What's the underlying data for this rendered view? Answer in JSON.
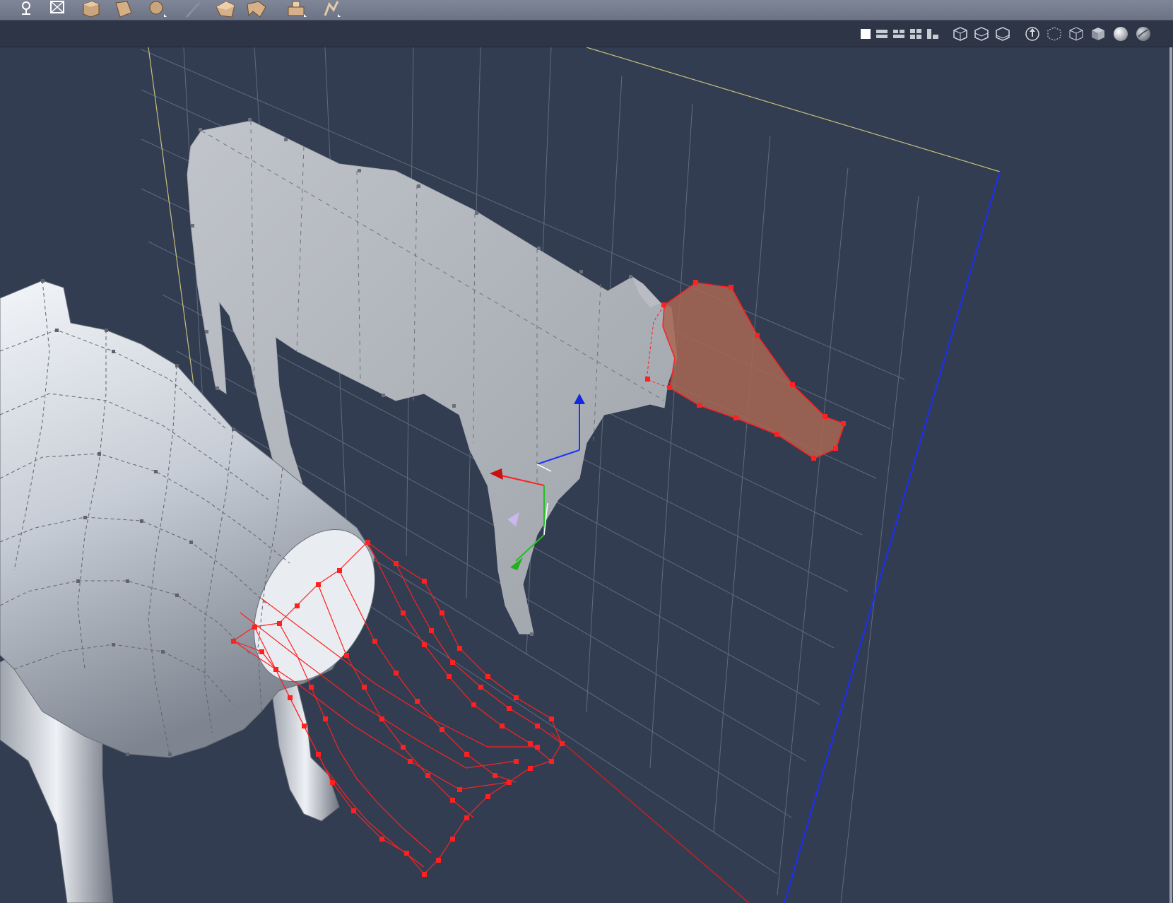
{
  "app": {
    "title": ""
  },
  "toolbar": {
    "tools": [
      {
        "icon": "light-bulb-icon"
      },
      {
        "icon": "frame-icon"
      },
      {
        "icon": "box-primitive-icon"
      },
      {
        "icon": "plane-primitive-icon"
      },
      {
        "icon": "sphere-primitive-icon"
      },
      {
        "icon": "edit-wand-icon"
      },
      {
        "icon": "deform-tool-icon"
      },
      {
        "icon": "bend-tool-icon"
      },
      {
        "icon": "extrude-tool-icon"
      },
      {
        "icon": "magnet-tool-icon"
      }
    ]
  },
  "view_controls": {
    "layouts": [
      {
        "icon": "single-view-icon",
        "active": true
      },
      {
        "icon": "two-horizontal-views-icon"
      },
      {
        "icon": "two-vertical-views-icon"
      },
      {
        "icon": "four-views-icon"
      },
      {
        "icon": "three-views-icon"
      }
    ],
    "shading_modes": [
      {
        "icon": "wire-hidden-icon"
      },
      {
        "icon": "wire-shaded-icon"
      },
      {
        "icon": "wire-lit-icon"
      },
      {
        "icon": "axis-tripod-icon"
      },
      {
        "icon": "bounding-box-dotted-icon"
      },
      {
        "icon": "wireframe-cube-icon"
      },
      {
        "icon": "solid-cube-icon"
      },
      {
        "icon": "smooth-sphere-icon"
      },
      {
        "icon": "textured-sphere-icon"
      }
    ]
  },
  "colors": {
    "viewport_bg": "#323d51",
    "toolbar_bg": "#767d8f",
    "selection": "#ff2020",
    "mesh": "#c8ccd2",
    "grid": "#6a7588",
    "axis_x": "#ff3030",
    "axis_y": "#20c020",
    "axis_z": "#2040ff"
  }
}
